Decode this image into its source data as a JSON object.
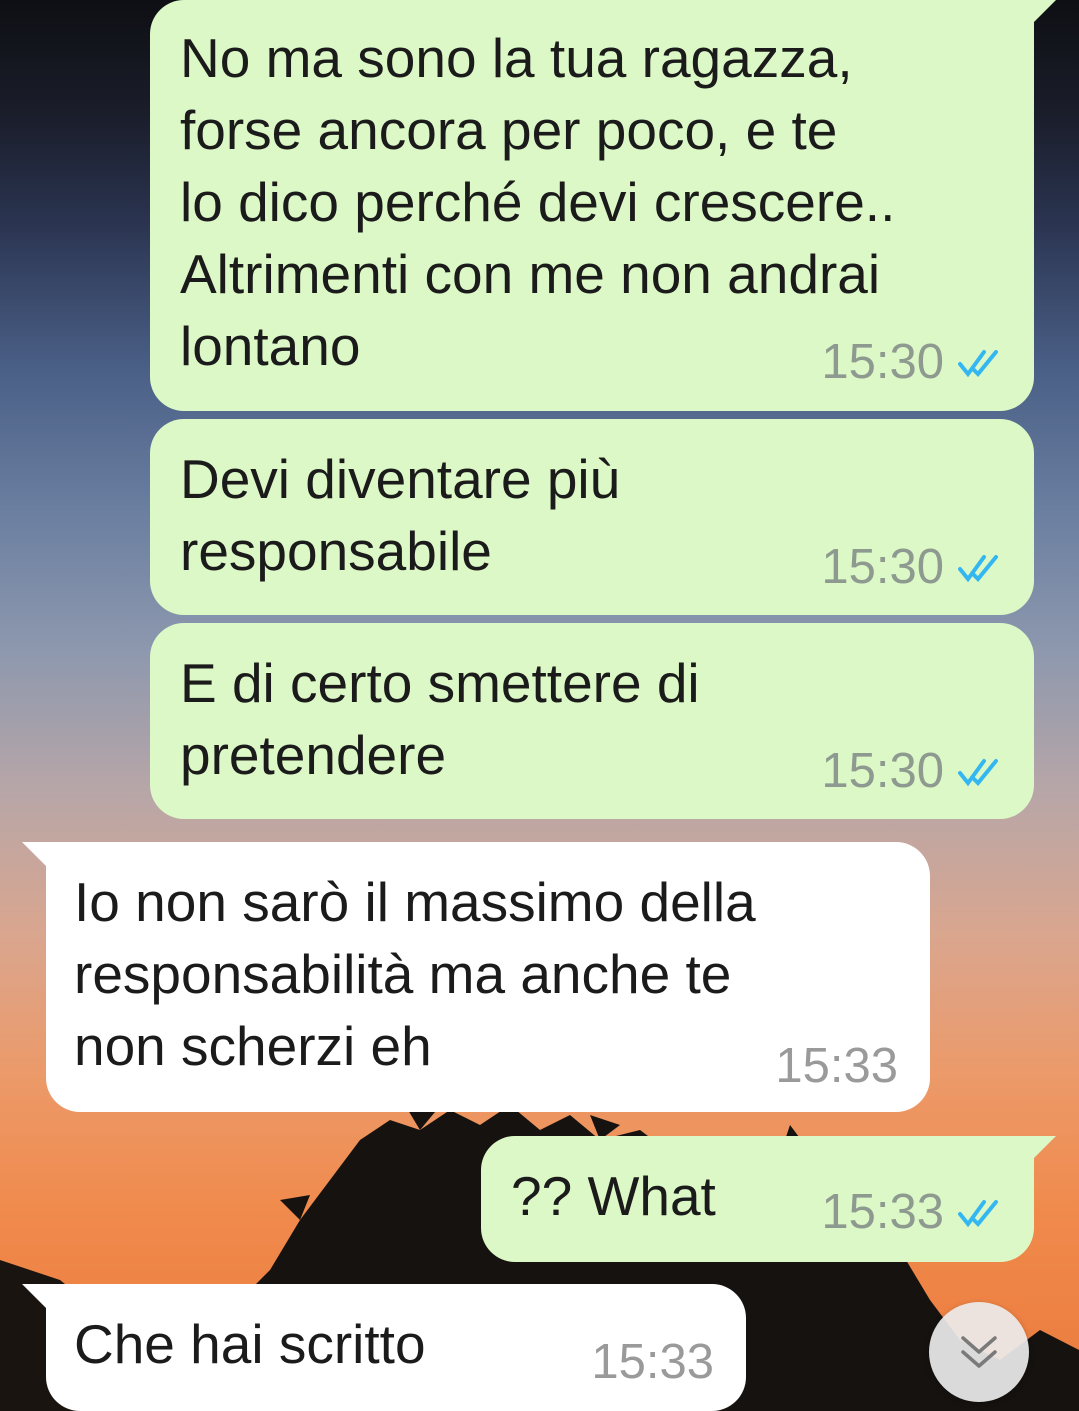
{
  "conversation": {
    "messages": [
      {
        "direction": "outgoing",
        "text": "No ma sono la tua ragazza,\nforse ancora per poco, e te\nlo dico perché devi crescere..\nAltrimenti con me non andrai\nlontano",
        "time": "15:30",
        "status": "read"
      },
      {
        "direction": "outgoing",
        "text": "Devi diventare più\nresponsabile",
        "time": "15:30",
        "status": "read"
      },
      {
        "direction": "outgoing",
        "text": "E di certo smettere di\npretendere",
        "time": "15:30",
        "status": "read"
      },
      {
        "direction": "incoming",
        "text": "Io non sarò il massimo della\nresponsabilità ma anche te\nnon scherzi eh",
        "time": "15:33"
      },
      {
        "direction": "outgoing",
        "text": "?? What",
        "time": "15:33",
        "status": "read"
      },
      {
        "direction": "incoming",
        "text": "Che hai scritto",
        "time": "15:33"
      }
    ]
  },
  "colors": {
    "outgoing_bubble": "#dcf8c6",
    "incoming_bubble": "#ffffff",
    "read_ticks": "#34b7f1"
  },
  "icons": {
    "read_receipt": "double-check-icon",
    "scroll_to_bottom": "chevron-double-down-icon"
  }
}
